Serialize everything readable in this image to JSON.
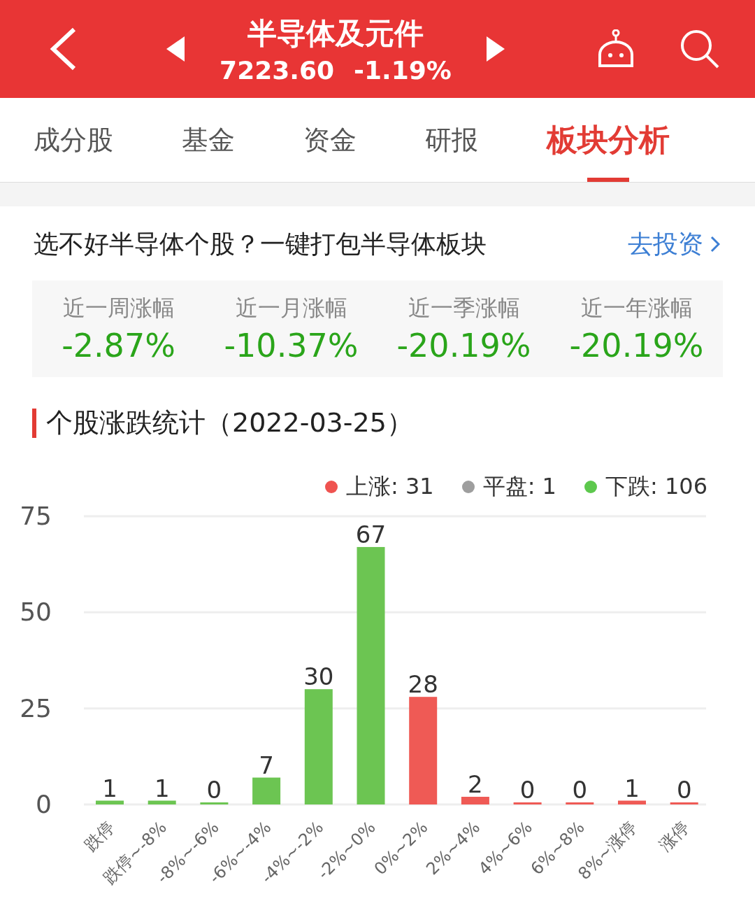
{
  "header": {
    "title": "半导体及元件",
    "price": "7223.60",
    "change": "-1.19%"
  },
  "tabs": [
    {
      "label": "成分股",
      "selected": false
    },
    {
      "label": "基金",
      "selected": false
    },
    {
      "label": "资金",
      "selected": false
    },
    {
      "label": "研报",
      "selected": false
    },
    {
      "label": "板块分析",
      "selected": true
    }
  ],
  "promo": {
    "text": "选不好半导体个股？一键打包半导体板块",
    "link": "去投资"
  },
  "stats": [
    {
      "label": "近一周涨幅",
      "value": "-2.87%"
    },
    {
      "label": "近一月涨幅",
      "value": "-10.37%"
    },
    {
      "label": "近一季涨幅",
      "value": "-20.19%"
    },
    {
      "label": "近一年涨幅",
      "value": "-20.19%"
    }
  ],
  "section": {
    "title": "个股涨跌统计（2022-03-25）"
  },
  "legend": [
    {
      "label": "上涨: 31",
      "color": "#ef5350"
    },
    {
      "label": "平盘: 1",
      "color": "#9e9e9e"
    },
    {
      "label": "下跌: 106",
      "color": "#5dc84d"
    }
  ],
  "chart_data": {
    "type": "bar",
    "data_labels": true,
    "categories": [
      "跌停",
      "跌停~-8%",
      "-8%~-6%",
      "-6%~-4%",
      "-4%~-2%",
      "-2%~0%",
      "0%~2%",
      "2%~4%",
      "4%~6%",
      "6%~8%",
      "8%~涨停",
      "涨停"
    ],
    "ylim": [
      0,
      75
    ],
    "yticks": [
      0,
      25,
      50,
      75
    ],
    "series": [
      {
        "color": "#6cc552",
        "values": [
          1,
          1,
          0,
          7,
          30,
          67,
          null,
          null,
          null,
          null,
          null,
          null
        ]
      },
      {
        "color": "#ef5a55",
        "values": [
          null,
          null,
          null,
          null,
          null,
          null,
          28,
          2,
          0,
          0,
          1,
          0
        ]
      }
    ]
  }
}
